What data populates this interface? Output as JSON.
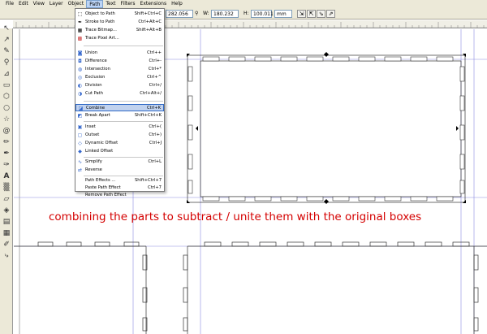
{
  "menubar": {
    "items": [
      "File",
      "Edit",
      "View",
      "Layer",
      "Object",
      "Path",
      "Text",
      "Filters",
      "Extensions",
      "Help"
    ],
    "open_index": 5
  },
  "toolbar": {
    "x_value": "282.056",
    "w_label": "W:",
    "w_value": "180.232",
    "h_label": "H:",
    "h_value": "100.011",
    "unit": "mm"
  },
  "path_menu": {
    "items": [
      {
        "icon": "object-to-path-icon",
        "label": "Object to Path",
        "shortcut": "Shift+Ctrl+C"
      },
      {
        "icon": "stroke-to-path-icon",
        "label": "Stroke to Path",
        "shortcut": "Ctrl+Alt+C"
      },
      {
        "icon": "trace-bitmap-icon",
        "label": "Trace Bitmap...",
        "shortcut": "Shift+Alt+B"
      },
      {
        "icon": "trace-pixel-art-icon",
        "label": "Trace Pixel Art...",
        "shortcut": ""
      },
      {
        "icon": "union-icon",
        "label": "Union",
        "shortcut": "Ctrl++"
      },
      {
        "icon": "difference-icon",
        "label": "Difference",
        "shortcut": "Ctrl+-"
      },
      {
        "icon": "intersection-icon",
        "label": "Intersection",
        "shortcut": "Ctrl+*"
      },
      {
        "icon": "exclusion-icon",
        "label": "Exclusion",
        "shortcut": "Ctrl+^"
      },
      {
        "icon": "division-icon",
        "label": "Division",
        "shortcut": "Ctrl+/"
      },
      {
        "icon": "cut-path-icon",
        "label": "Cut Path",
        "shortcut": "Ctrl+Alt+/"
      },
      {
        "icon": "combine-icon",
        "label": "Combine",
        "shortcut": "Ctrl+K"
      },
      {
        "icon": "break-apart-icon",
        "label": "Break Apart",
        "shortcut": "Shift+Ctrl+K"
      },
      {
        "icon": "inset-icon",
        "label": "Inset",
        "shortcut": "Ctrl+("
      },
      {
        "icon": "outset-icon",
        "label": "Outset",
        "shortcut": "Ctrl+)"
      },
      {
        "icon": "dynamic-offset-icon",
        "label": "Dynamic Offset",
        "shortcut": "Ctrl+J"
      },
      {
        "icon": "linked-offset-icon",
        "label": "Linked Offset",
        "shortcut": ""
      },
      {
        "icon": "simplify-icon",
        "label": "Simplify",
        "shortcut": "Ctrl+L"
      },
      {
        "icon": "reverse-icon",
        "label": "Reverse",
        "shortcut": ""
      },
      {
        "icon": "",
        "label": "Path Effects ...",
        "shortcut": "Shift+Ctrl+7"
      },
      {
        "icon": "",
        "label": "Paste Path Effect",
        "shortcut": "Ctrl+7"
      },
      {
        "icon": "",
        "label": "Remove Path Effect",
        "shortcut": ""
      }
    ],
    "highlighted": "Combine"
  },
  "annotation": "combining the parts to subtract / unite them with the original boxes",
  "colors": {
    "annotation": "#d40000",
    "guide": "#7b7bd8",
    "highlight": "#c1d2ee"
  }
}
